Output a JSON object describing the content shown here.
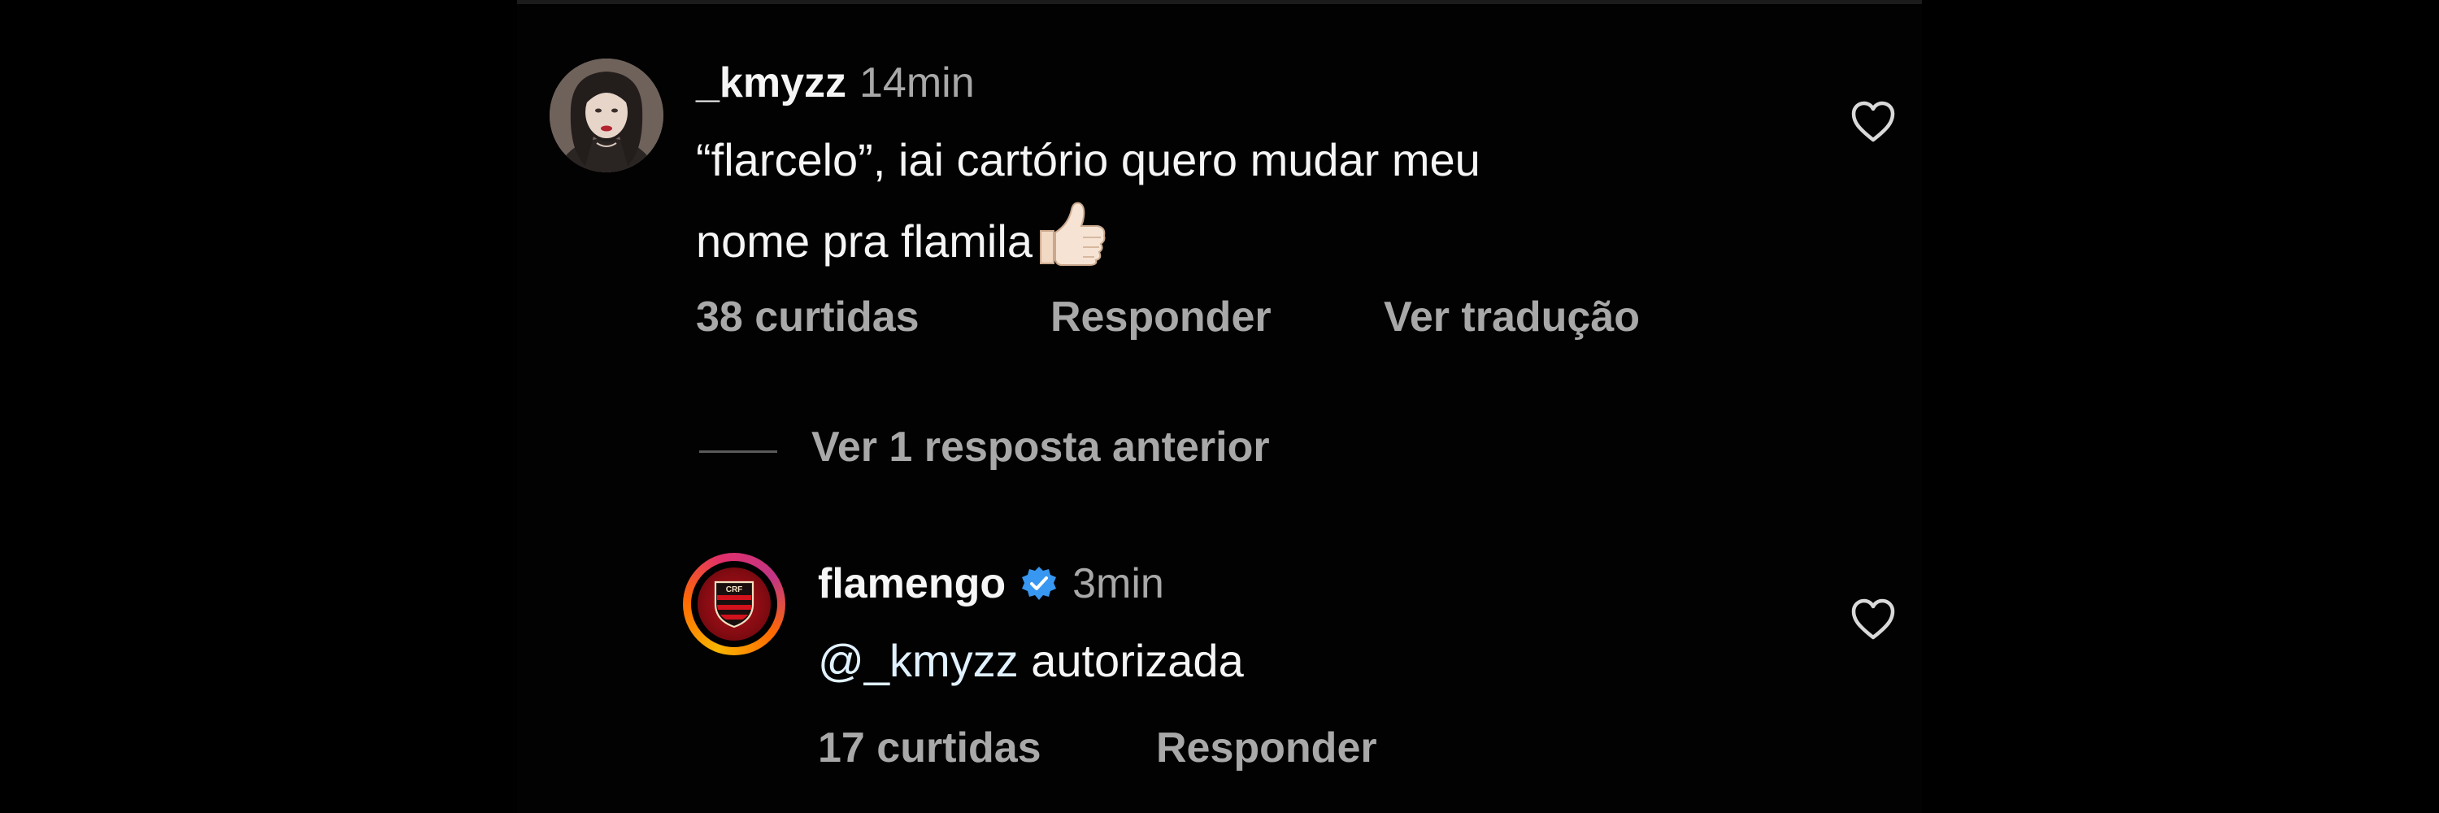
{
  "comments": [
    {
      "username": "_kmyzz",
      "time": "14min",
      "text_line1": "“flarcelo”, iai cartório quero mudar meu",
      "text_line2": "nome pra flamila",
      "likes": "38 curtidas",
      "reply_label": "Responder",
      "translate_label": "Ver tradução",
      "like_icon": "heart-outline-icon"
    }
  ],
  "replies_toggle": {
    "label": "Ver 1 resposta anterior"
  },
  "reply": {
    "username": "flamengo",
    "verified": true,
    "time": "3min",
    "mention": "@_kmyzz",
    "text": " autorizada",
    "likes": "17 curtidas",
    "reply_label": "Responder",
    "like_icon": "heart-outline-icon"
  },
  "colors": {
    "background": "#000000",
    "primary_text": "#f5f5f5",
    "secondary_text": "#a8a8a8",
    "verified_blue": "#3897f0",
    "flamengo_red": "#b5121b"
  }
}
